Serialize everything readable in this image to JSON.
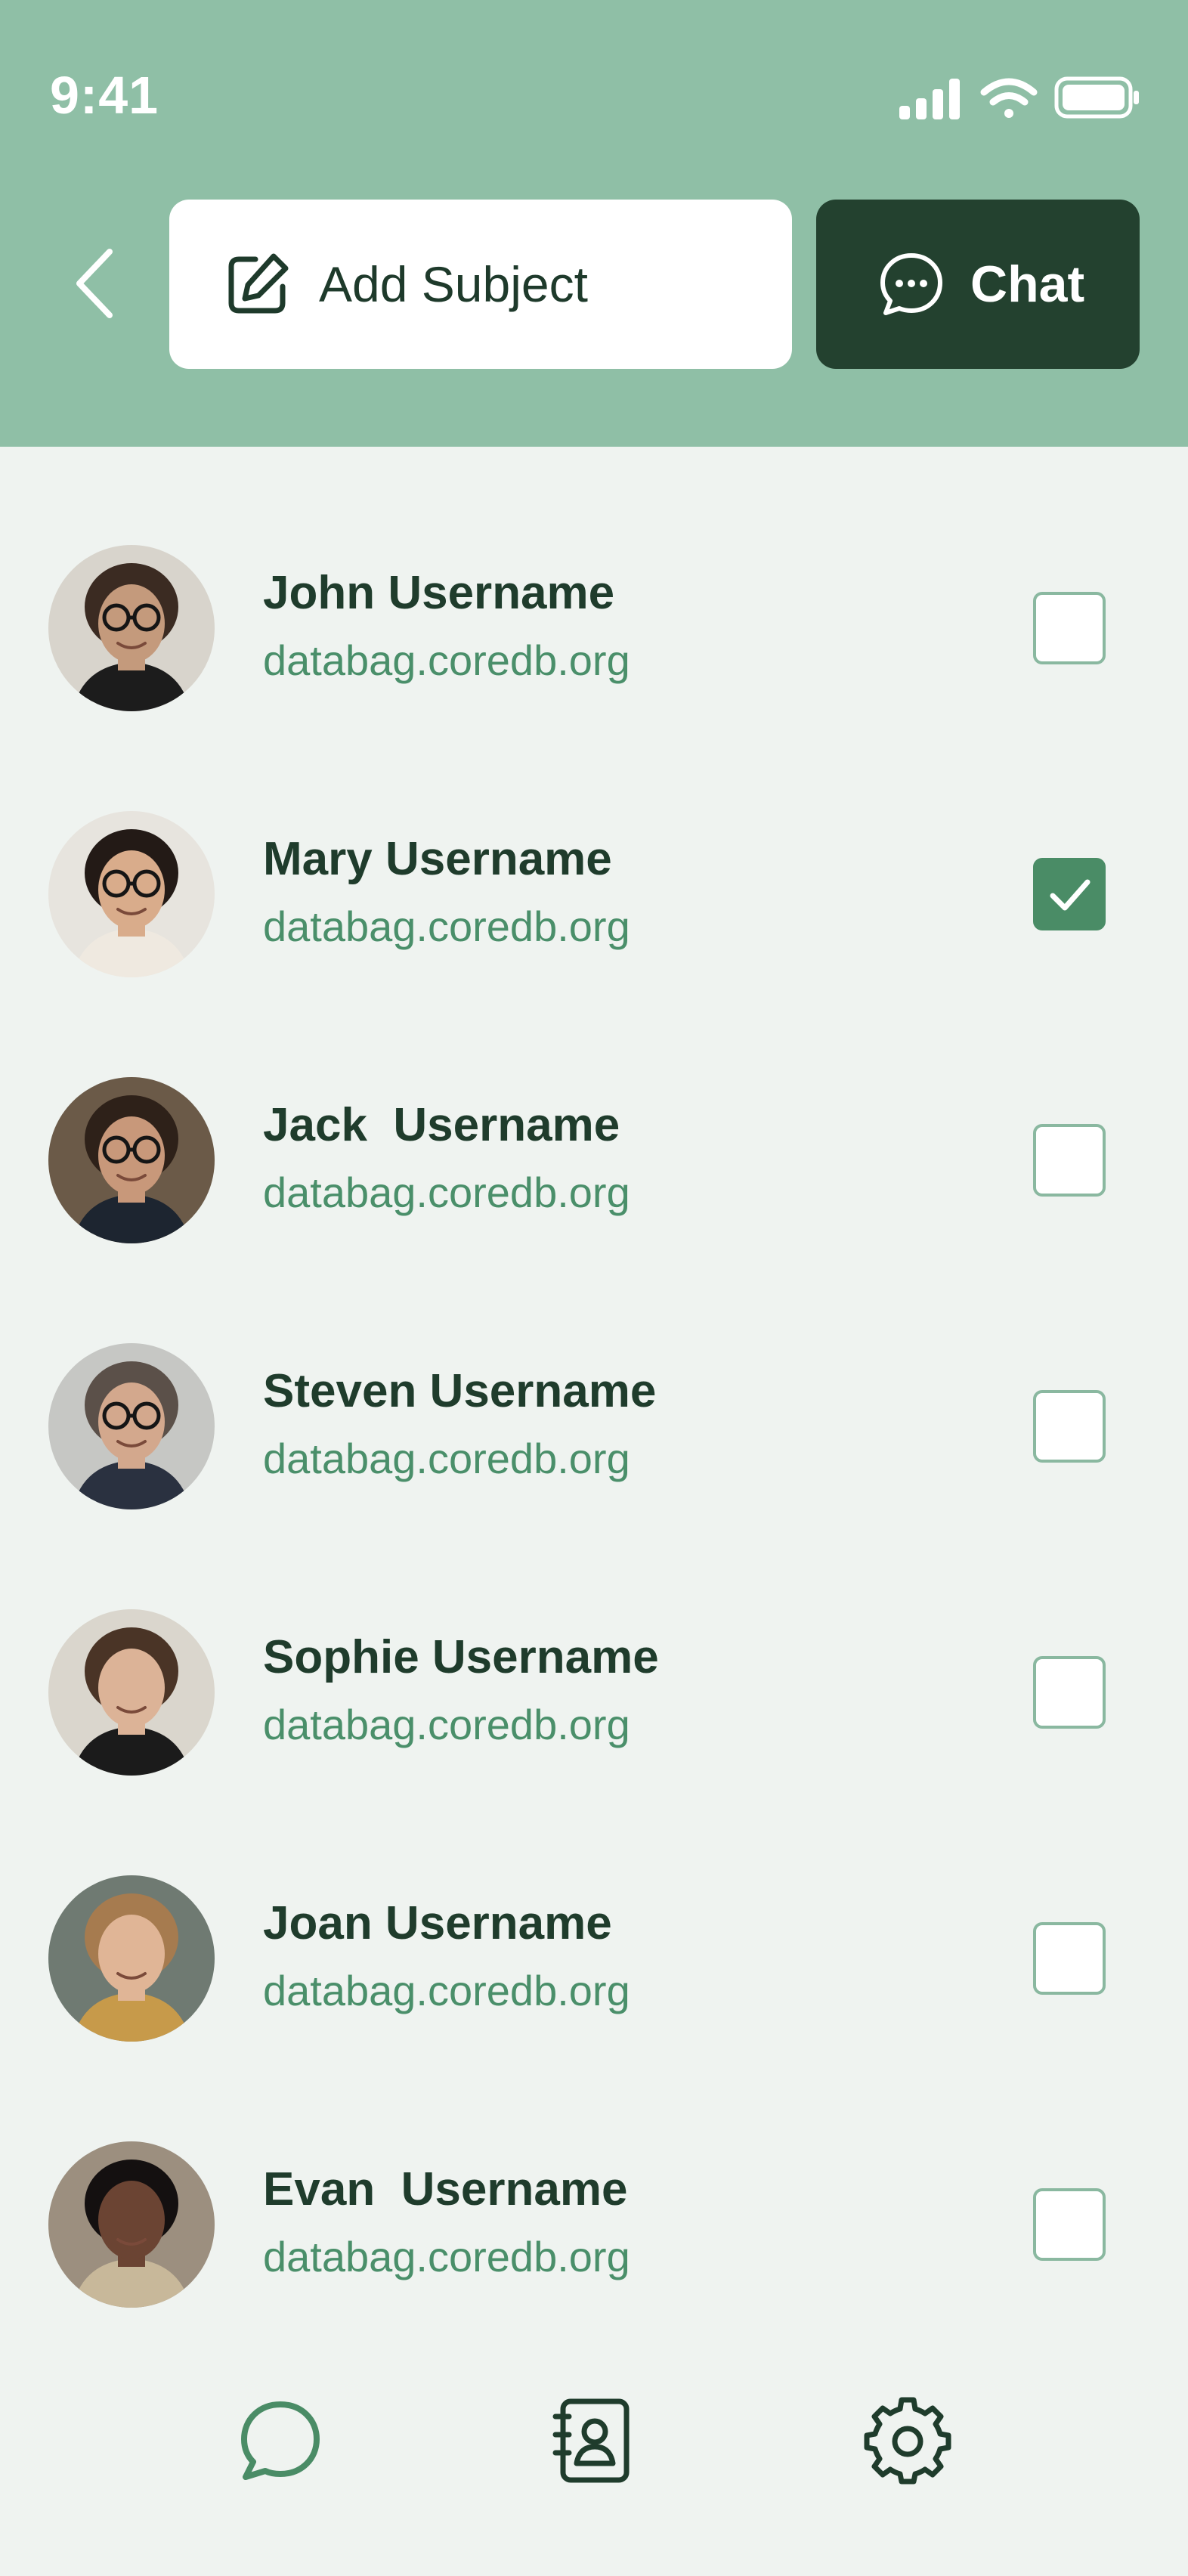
{
  "status_bar": {
    "time": "9:41"
  },
  "header": {
    "add_subject_label": "Add Subject",
    "chat_label": "Chat"
  },
  "contacts": [
    {
      "name": "John Username",
      "domain": "databag.coredb.org",
      "checked": false,
      "skin": "#c49a7c",
      "hair": "#3b2b22",
      "bg": "#d8d4cc",
      "shirt": "#1c1c1c",
      "glasses": true
    },
    {
      "name": "Mary Username",
      "domain": "databag.coredb.org",
      "checked": true,
      "skin": "#d9ac8b",
      "hair": "#231a16",
      "bg": "#e7e4de",
      "shirt": "#efe9e0",
      "glasses": true
    },
    {
      "name": "Jack  Username",
      "domain": "databag.coredb.org",
      "checked": false,
      "skin": "#c8987a",
      "hair": "#2e2119",
      "bg": "#6b5a48",
      "shirt": "#1d2530",
      "glasses": true
    },
    {
      "name": "Steven Username",
      "domain": "databag.coredb.org",
      "checked": false,
      "skin": "#d3a88d",
      "hair": "#5b5049",
      "bg": "#c6c7c4",
      "shirt": "#2a3140",
      "glasses": true
    },
    {
      "name": "Sophie Username",
      "domain": "databag.coredb.org",
      "checked": false,
      "skin": "#dcb397",
      "hair": "#4a3426",
      "bg": "#dad6cd",
      "shirt": "#1b1b1b",
      "glasses": false
    },
    {
      "name": "Joan Username",
      "domain": "databag.coredb.org",
      "checked": false,
      "skin": "#e0b596",
      "hair": "#a67b4f",
      "bg": "#6f7a72",
      "shirt": "#c79a4a",
      "glasses": false
    },
    {
      "name": "Evan  Username",
      "domain": "databag.coredb.org",
      "checked": false,
      "skin": "#6b4433",
      "hair": "#141010",
      "bg": "#9c8f7f",
      "shirt": "#c8b89a",
      "glasses": false
    }
  ],
  "bottom_nav": [
    {
      "icon": "chat-bubble-icon"
    },
    {
      "icon": "contacts-book-icon"
    },
    {
      "icon": "settings-gear-icon"
    }
  ],
  "colors": {
    "header_bg": "#8fbfa6",
    "chat_button_bg": "#23412f",
    "accent": "#4a8c66",
    "page_bg": "#eff3f0"
  }
}
